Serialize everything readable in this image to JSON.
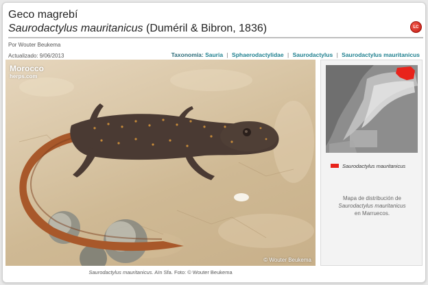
{
  "header": {
    "title": "Geco magrebí",
    "scientific_name": "Saurodactylus mauritanicus",
    "authority": "(Duméril & Bibron, 1836)",
    "status_badge": "LC"
  },
  "meta": {
    "author": "Por Wouter Beukema",
    "updated": "Actualizado: 9/06/2013"
  },
  "taxonomy": {
    "label": "Taxonomía:",
    "separator": "|",
    "items": [
      "Sauria",
      "Sphaerodactylidae",
      "Saurodactylus",
      "Saurodactylus mauritanicus"
    ]
  },
  "photo": {
    "logo_line1": "Morocco",
    "logo_line2": "herps.com",
    "watermark": "© Wouter Beukema",
    "caption_sci": "Saurodactylus mauritanicus",
    "caption_rest": ". Aïn Sfa. Foto: © Wouter Beukema"
  },
  "map": {
    "legend_label": "Saurodactylus mauritanicus",
    "legend_color": "#e8231b",
    "desc_line1": "Mapa de distribución de",
    "desc_sci": "Saurodactylus mauritanicus",
    "desc_line3": "en Marruecos."
  }
}
